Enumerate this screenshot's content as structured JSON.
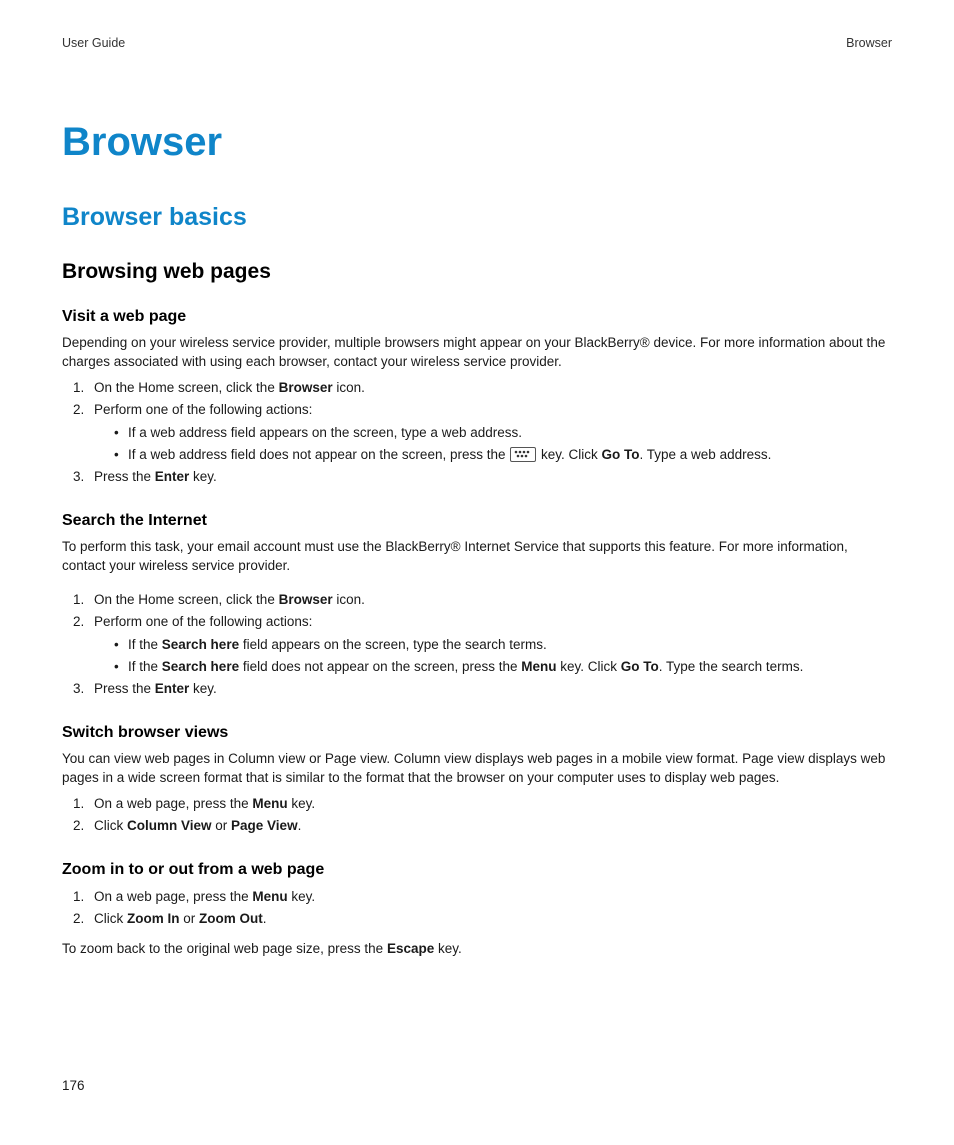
{
  "header": {
    "left": "User Guide",
    "right": "Browser"
  },
  "title": "Browser",
  "section": "Browser basics",
  "subsection": "Browsing web pages",
  "topics": {
    "visit": {
      "heading": "Visit a web page",
      "intro": "Depending on your wireless service provider, multiple browsers might appear on your BlackBerry® device. For more information about the charges associated with using each browser, contact your wireless service provider.",
      "step1_a": "On the Home screen, click the ",
      "step1_b": "Browser",
      "step1_c": " icon.",
      "step2": "Perform one of the following actions:",
      "bullet1": "If a web address field appears on the screen, type a web address.",
      "bullet2_a": "If a web address field does not appear on the screen, press the ",
      "bullet2_b": " key. Click ",
      "bullet2_c": "Go To",
      "bullet2_d": ". Type a web address.",
      "step3_a": "Press the ",
      "step3_b": "Enter",
      "step3_c": " key."
    },
    "search": {
      "heading": "Search the Internet",
      "intro": "To perform this task, your email account must use the BlackBerry® Internet Service that supports this feature. For more information, contact your wireless service provider.",
      "step1_a": "On the Home screen, click the ",
      "step1_b": "Browser",
      "step1_c": " icon.",
      "step2": "Perform one of the following actions:",
      "bullet1_a": "If the ",
      "bullet1_b": "Search here",
      "bullet1_c": " field appears on the screen, type the search terms.",
      "bullet2_a": "If the ",
      "bullet2_b": "Search here",
      "bullet2_c": " field does not appear on the screen, press the ",
      "bullet2_d": "Menu",
      "bullet2_e": " key. Click ",
      "bullet2_f": "Go To",
      "bullet2_g": ". Type the search terms.",
      "step3_a": "Press the ",
      "step3_b": "Enter",
      "step3_c": " key."
    },
    "switch": {
      "heading": "Switch browser views",
      "intro": "You can view web pages in Column view or Page view. Column view displays web pages in a mobile view format. Page view displays web pages in a wide screen format that is similar to the format that the browser on your computer uses to display web pages.",
      "step1_a": "On a web page, press the ",
      "step1_b": "Menu",
      "step1_c": " key.",
      "step2_a": "Click ",
      "step2_b": "Column View",
      "step2_c": " or ",
      "step2_d": "Page View",
      "step2_e": "."
    },
    "zoom": {
      "heading": "Zoom in to or out from a web page",
      "step1_a": "On a web page, press the ",
      "step1_b": "Menu",
      "step1_c": " key.",
      "step2_a": "Click ",
      "step2_b": "Zoom In",
      "step2_c": " or ",
      "step2_d": "Zoom Out",
      "step2_e": ".",
      "outro_a": "To zoom back to the original web page size, press the ",
      "outro_b": "Escape",
      "outro_c": " key."
    }
  },
  "page_number": "176"
}
